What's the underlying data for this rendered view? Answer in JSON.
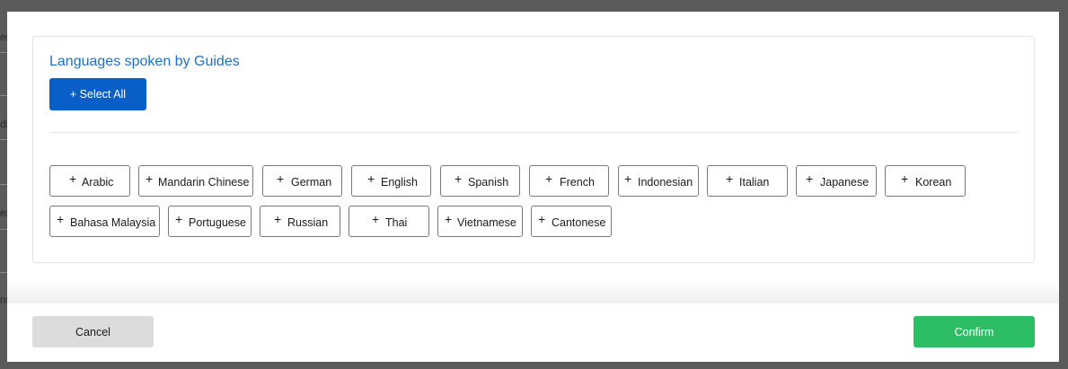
{
  "background_page": {
    "row_texts": [
      "er",
      "dic",
      "er",
      "nte"
    ]
  },
  "modal": {
    "section_title": "Languages spoken by Guides",
    "select_all_label": "+ Select All",
    "plus_symbol": "+",
    "languages_row1": [
      "Arabic",
      "Mandarin Chinese",
      "German",
      "English",
      "Spanish",
      "French",
      "Indonesian",
      "Italian",
      "Japanese",
      "Korean"
    ],
    "languages_row2": [
      "Bahasa Malaysia",
      "Portuguese",
      "Russian",
      "Thai",
      "Vietnamese",
      "Cantonese"
    ],
    "cancel_label": "Cancel",
    "confirm_label": "Confirm"
  },
  "colors": {
    "title": "#1f6fc5",
    "select_all_bg": "#0a5ec8",
    "confirm_bg": "#2dbd64",
    "cancel_bg": "#dcdcdc",
    "overlay": "#5b5b5b"
  }
}
